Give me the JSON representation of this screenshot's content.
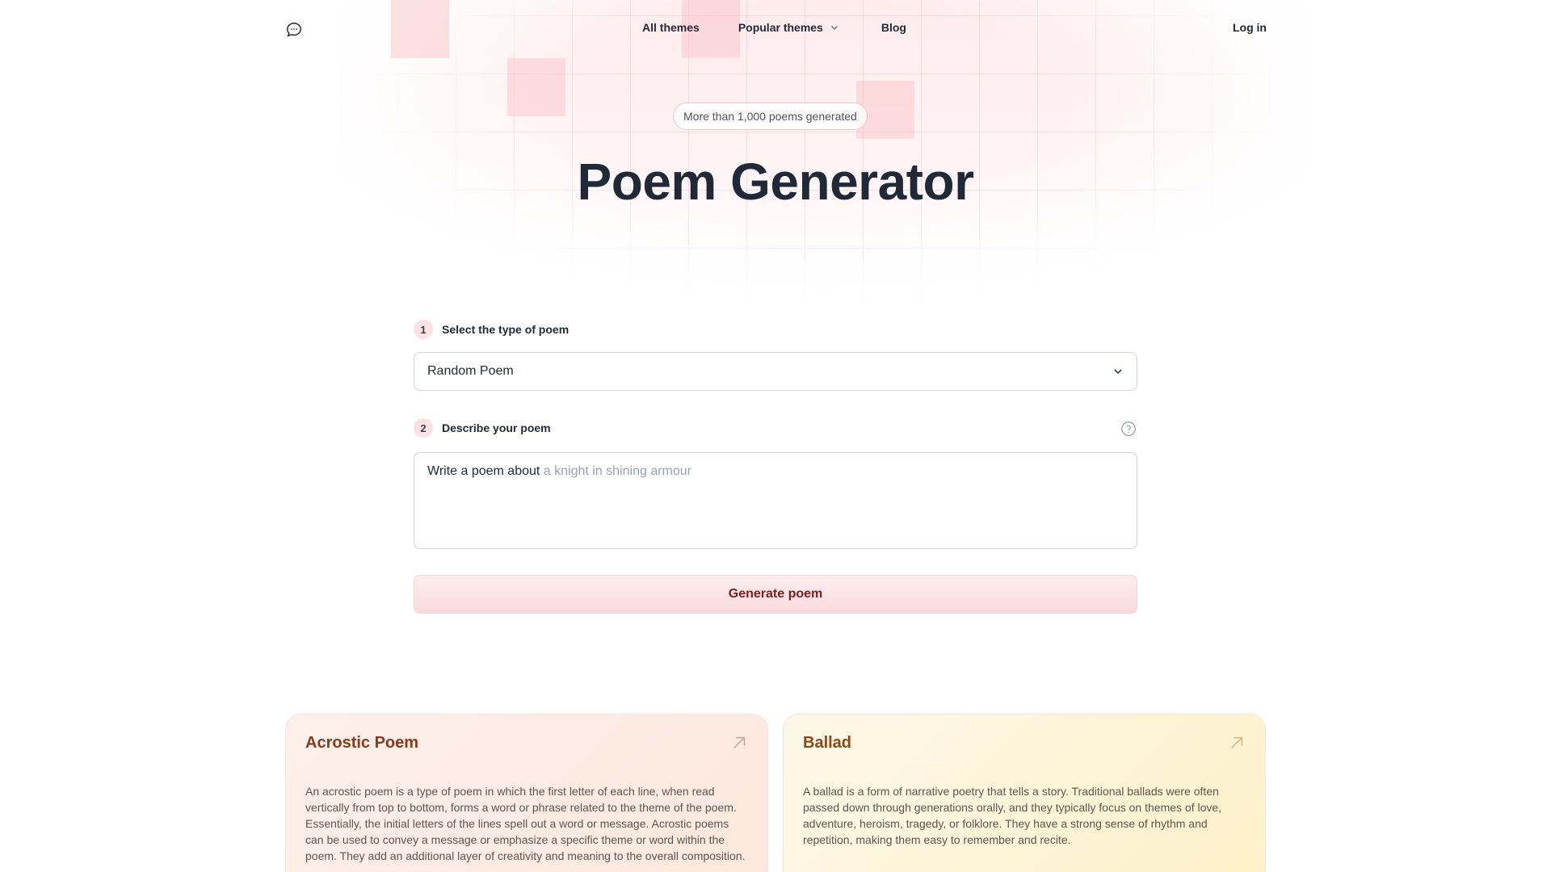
{
  "nav": {
    "logo_icon": "chat-bubble-icon",
    "all_themes": "All themes",
    "popular_themes": "Popular themes",
    "blog": "Blog",
    "login": "Log in"
  },
  "hero": {
    "badge": "More than 1,000 poems generated",
    "title": "Poem Generator"
  },
  "form": {
    "step1": {
      "number": "1",
      "label": "Select the type of poem",
      "selected": "Random Poem"
    },
    "step2": {
      "number": "2",
      "label": "Describe your poem",
      "prefix": "Write a poem about",
      "placeholder": "a knight in shining armour"
    },
    "generate_label": "Generate poem"
  },
  "cards": [
    {
      "title": "Acrostic Poem",
      "description": "An acrostic poem is a type of poem in which the first letter of each line, when read vertically from top to bottom, forms a word or phrase related to the theme of the poem. Essentially, the initial letters of the lines spell out a word or message. Acrostic poems can be used to convey a message or emphasize a specific theme or word within the poem. They add an additional layer of creativity and meaning to the overall composition."
    },
    {
      "title": "Ballad",
      "description": "A ballad is a form of narrative poetry that tells a story. Traditional ballads were often passed down through generations orally, and they typically focus on themes of love, adventure, heroism, tragedy, or folklore. They have a strong sense of rhythm and repetition, making them easy to remember and recite."
    }
  ],
  "colors": {
    "accent": "#fadadd",
    "button_text": "#7f1d1d",
    "acrostic_title": "#8a3a1c",
    "ballad_title": "#8a4a16"
  }
}
